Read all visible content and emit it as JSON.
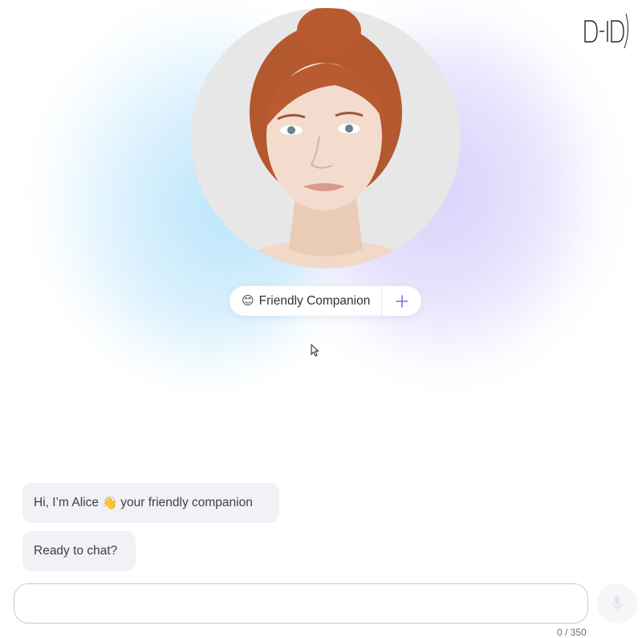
{
  "brand": {
    "logo_text": "D-ID"
  },
  "avatar": {
    "description_icon": "portrait-image"
  },
  "persona": {
    "emoji": "😊",
    "label": "Friendly Companion",
    "add_icon": "plus-icon"
  },
  "chat": {
    "messages": [
      {
        "before": "Hi, I’m Alice",
        "emoji": "👋",
        "after": "your friendly companion"
      },
      {
        "text": "Ready to chat?"
      }
    ]
  },
  "composer": {
    "value": "",
    "placeholder": "",
    "counter": "0 / 350",
    "mic_icon": "microphone-icon"
  },
  "colors": {
    "accent": "#7b6cf0",
    "bubble_bg": "#f1f1f6",
    "glow_blue": "#b9e4fb",
    "glow_purple": "#d9d0fb"
  }
}
